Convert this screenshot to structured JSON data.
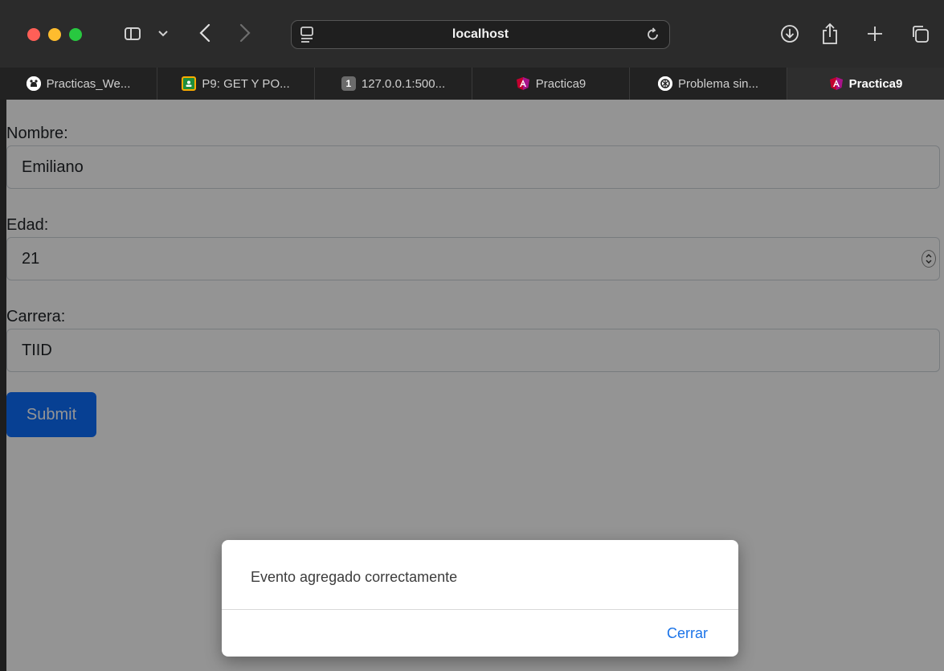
{
  "browser": {
    "url": "localhost",
    "traffic_colors": {
      "close": "#ff5f57",
      "minimize": "#febc2e",
      "maximize": "#28c840"
    },
    "icons": {
      "sidebar": "sidebar-icon",
      "sidebar_menu": "chevron-down-icon",
      "back": "back-arrow-icon",
      "forward": "forward-arrow-icon",
      "page_settings": "page-settings-icon",
      "reload": "reload-icon",
      "downloads": "download-icon",
      "share": "share-icon",
      "new_tab": "plus-icon",
      "tab_overview": "tab-overview-icon"
    }
  },
  "tabs": [
    {
      "label": "Practicas_We...",
      "icon": "github-icon",
      "active": false
    },
    {
      "label": "P9: GET Y PO...",
      "icon": "google-classroom-icon",
      "active": false
    },
    {
      "label": "127.0.0.1:500...",
      "icon": "number-badge-icon",
      "badge": "1",
      "active": false
    },
    {
      "label": "Practica9",
      "icon": "angular-icon",
      "active": false
    },
    {
      "label": "Problema sin...",
      "icon": "openai-icon",
      "active": false
    },
    {
      "label": "Practica9",
      "icon": "angular-icon",
      "active": true
    }
  ],
  "form": {
    "nombre": {
      "label": "Nombre:",
      "value": "Emiliano"
    },
    "edad": {
      "label": "Edad:",
      "value": "21"
    },
    "carrera": {
      "label": "Carrera:",
      "value": "TIID"
    },
    "submit_label": "Submit"
  },
  "dialog": {
    "message": "Evento agregado correctamente",
    "close_label": "Cerrar"
  },
  "colors": {
    "primary_button": "#0d6efd",
    "link": "#1a73e8"
  }
}
